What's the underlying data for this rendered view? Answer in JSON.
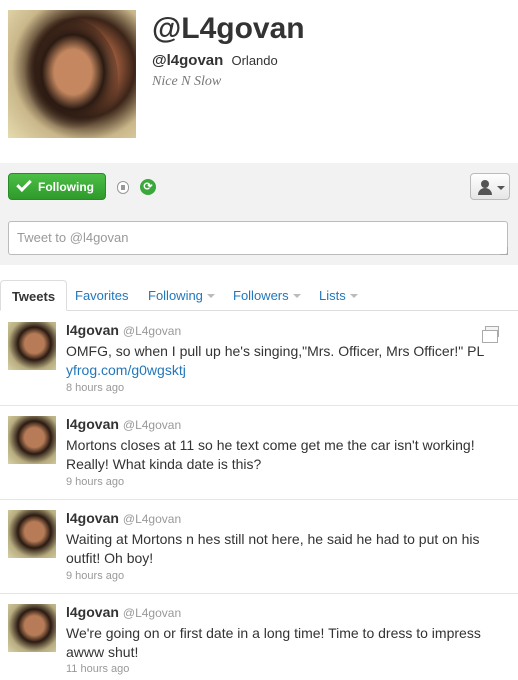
{
  "profile": {
    "title_handle": "@L4govan",
    "screen_name": "@l4govan",
    "location": "Orlando",
    "bio": "Nice N Slow"
  },
  "actions": {
    "follow_label": "Following"
  },
  "composer": {
    "placeholder": "Tweet to @l4govan"
  },
  "tabs": [
    {
      "label": "Tweets"
    },
    {
      "label": "Favorites"
    },
    {
      "label": "Following"
    },
    {
      "label": "Followers"
    },
    {
      "label": "Lists"
    }
  ],
  "tweets": [
    {
      "name": "l4govan",
      "handle": "@L4govan",
      "text": "OMFG, so when I pull up he's singing,\"Mrs. Officer, Mrs Officer!\" PL",
      "link": "yfrog.com/g0wgsktj",
      "time": "8 hours ago"
    },
    {
      "name": "l4govan",
      "handle": "@L4govan",
      "text": "Mortons closes at 11 so he text come get me the car isn't working! Really! What kinda date is this?",
      "time": "9 hours ago"
    },
    {
      "name": "l4govan",
      "handle": "@L4govan",
      "text": "Waiting at Mortons n hes still not here, he said he had to put on his outfit! Oh boy!",
      "time": "9 hours ago"
    },
    {
      "name": "l4govan",
      "handle": "@L4govan",
      "text": "We're going on or first date in a long time! Time to dress to impress awww shut!",
      "time": "11 hours ago"
    }
  ]
}
